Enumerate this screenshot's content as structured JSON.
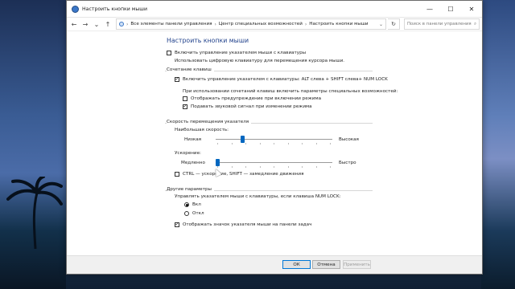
{
  "window": {
    "title": "Настроить кнопки мыши"
  },
  "address": {
    "crumbs": [
      "Все элементы панели управления",
      "Центр специальных возможностей",
      "Настроить кнопки мыши"
    ],
    "search_placeholder": "Поиск в панели управления"
  },
  "page": {
    "title": "Настроить кнопки мыши",
    "enable_mouse_keys": {
      "label": "Включить управление указателем мыши с клавиатуры",
      "checked": false
    },
    "enable_hint": "Использовать цифровую клавиатуру для перемещения курсора мыши."
  },
  "shortcut": {
    "group_label": "Сочетание клавиш",
    "enable_shortcut": {
      "label": "Включить управление указателем с клавиатуры: ALT слева + SHIFT слева+ NUM LOCK",
      "checked": true
    },
    "hint": "При использовании сочетаний клавиш включить параметры специальных возможностей:",
    "show_warning": {
      "label": "Отображать предупреждение при включении режима",
      "checked": false
    },
    "play_sound": {
      "label": "Подавать звуковой сигнал при изменении режима",
      "checked": true
    }
  },
  "speed": {
    "group_label": "Скорость перемещения указателя",
    "top_speed_label": "Наибольшая скорость:",
    "low_label": "Низкая",
    "high_label": "Высокая",
    "top_speed_value": 0.22,
    "accel_label": "Ускорение:",
    "slow_label": "Медленно",
    "fast_label": "Быстро",
    "accel_value": 0.0,
    "ctrl_shift": {
      "label": "CTRL — ускорение, SHIFT — замедление движения",
      "checked": false
    }
  },
  "other": {
    "group_label": "Другие параметры",
    "numlock_label": "Управлять указателем мыши с клавиатуры, если клавиша NUM LOCK:",
    "on_label": "Вкл",
    "off_label": "Откл",
    "selected": "on",
    "show_icon": {
      "label": "Отображать значок указателя мыши на панели задач",
      "checked": true
    }
  },
  "footer": {
    "ok": "ОК",
    "cancel": "Отмена",
    "apply": "Применить"
  },
  "icons": {
    "back": "←",
    "forward": "→",
    "up": "↑",
    "recent": "⌄",
    "refresh": "↻",
    "search": "⌕",
    "minimize": "—",
    "maximize": "☐",
    "close": "✕",
    "check": "✓",
    "sep": "›"
  }
}
